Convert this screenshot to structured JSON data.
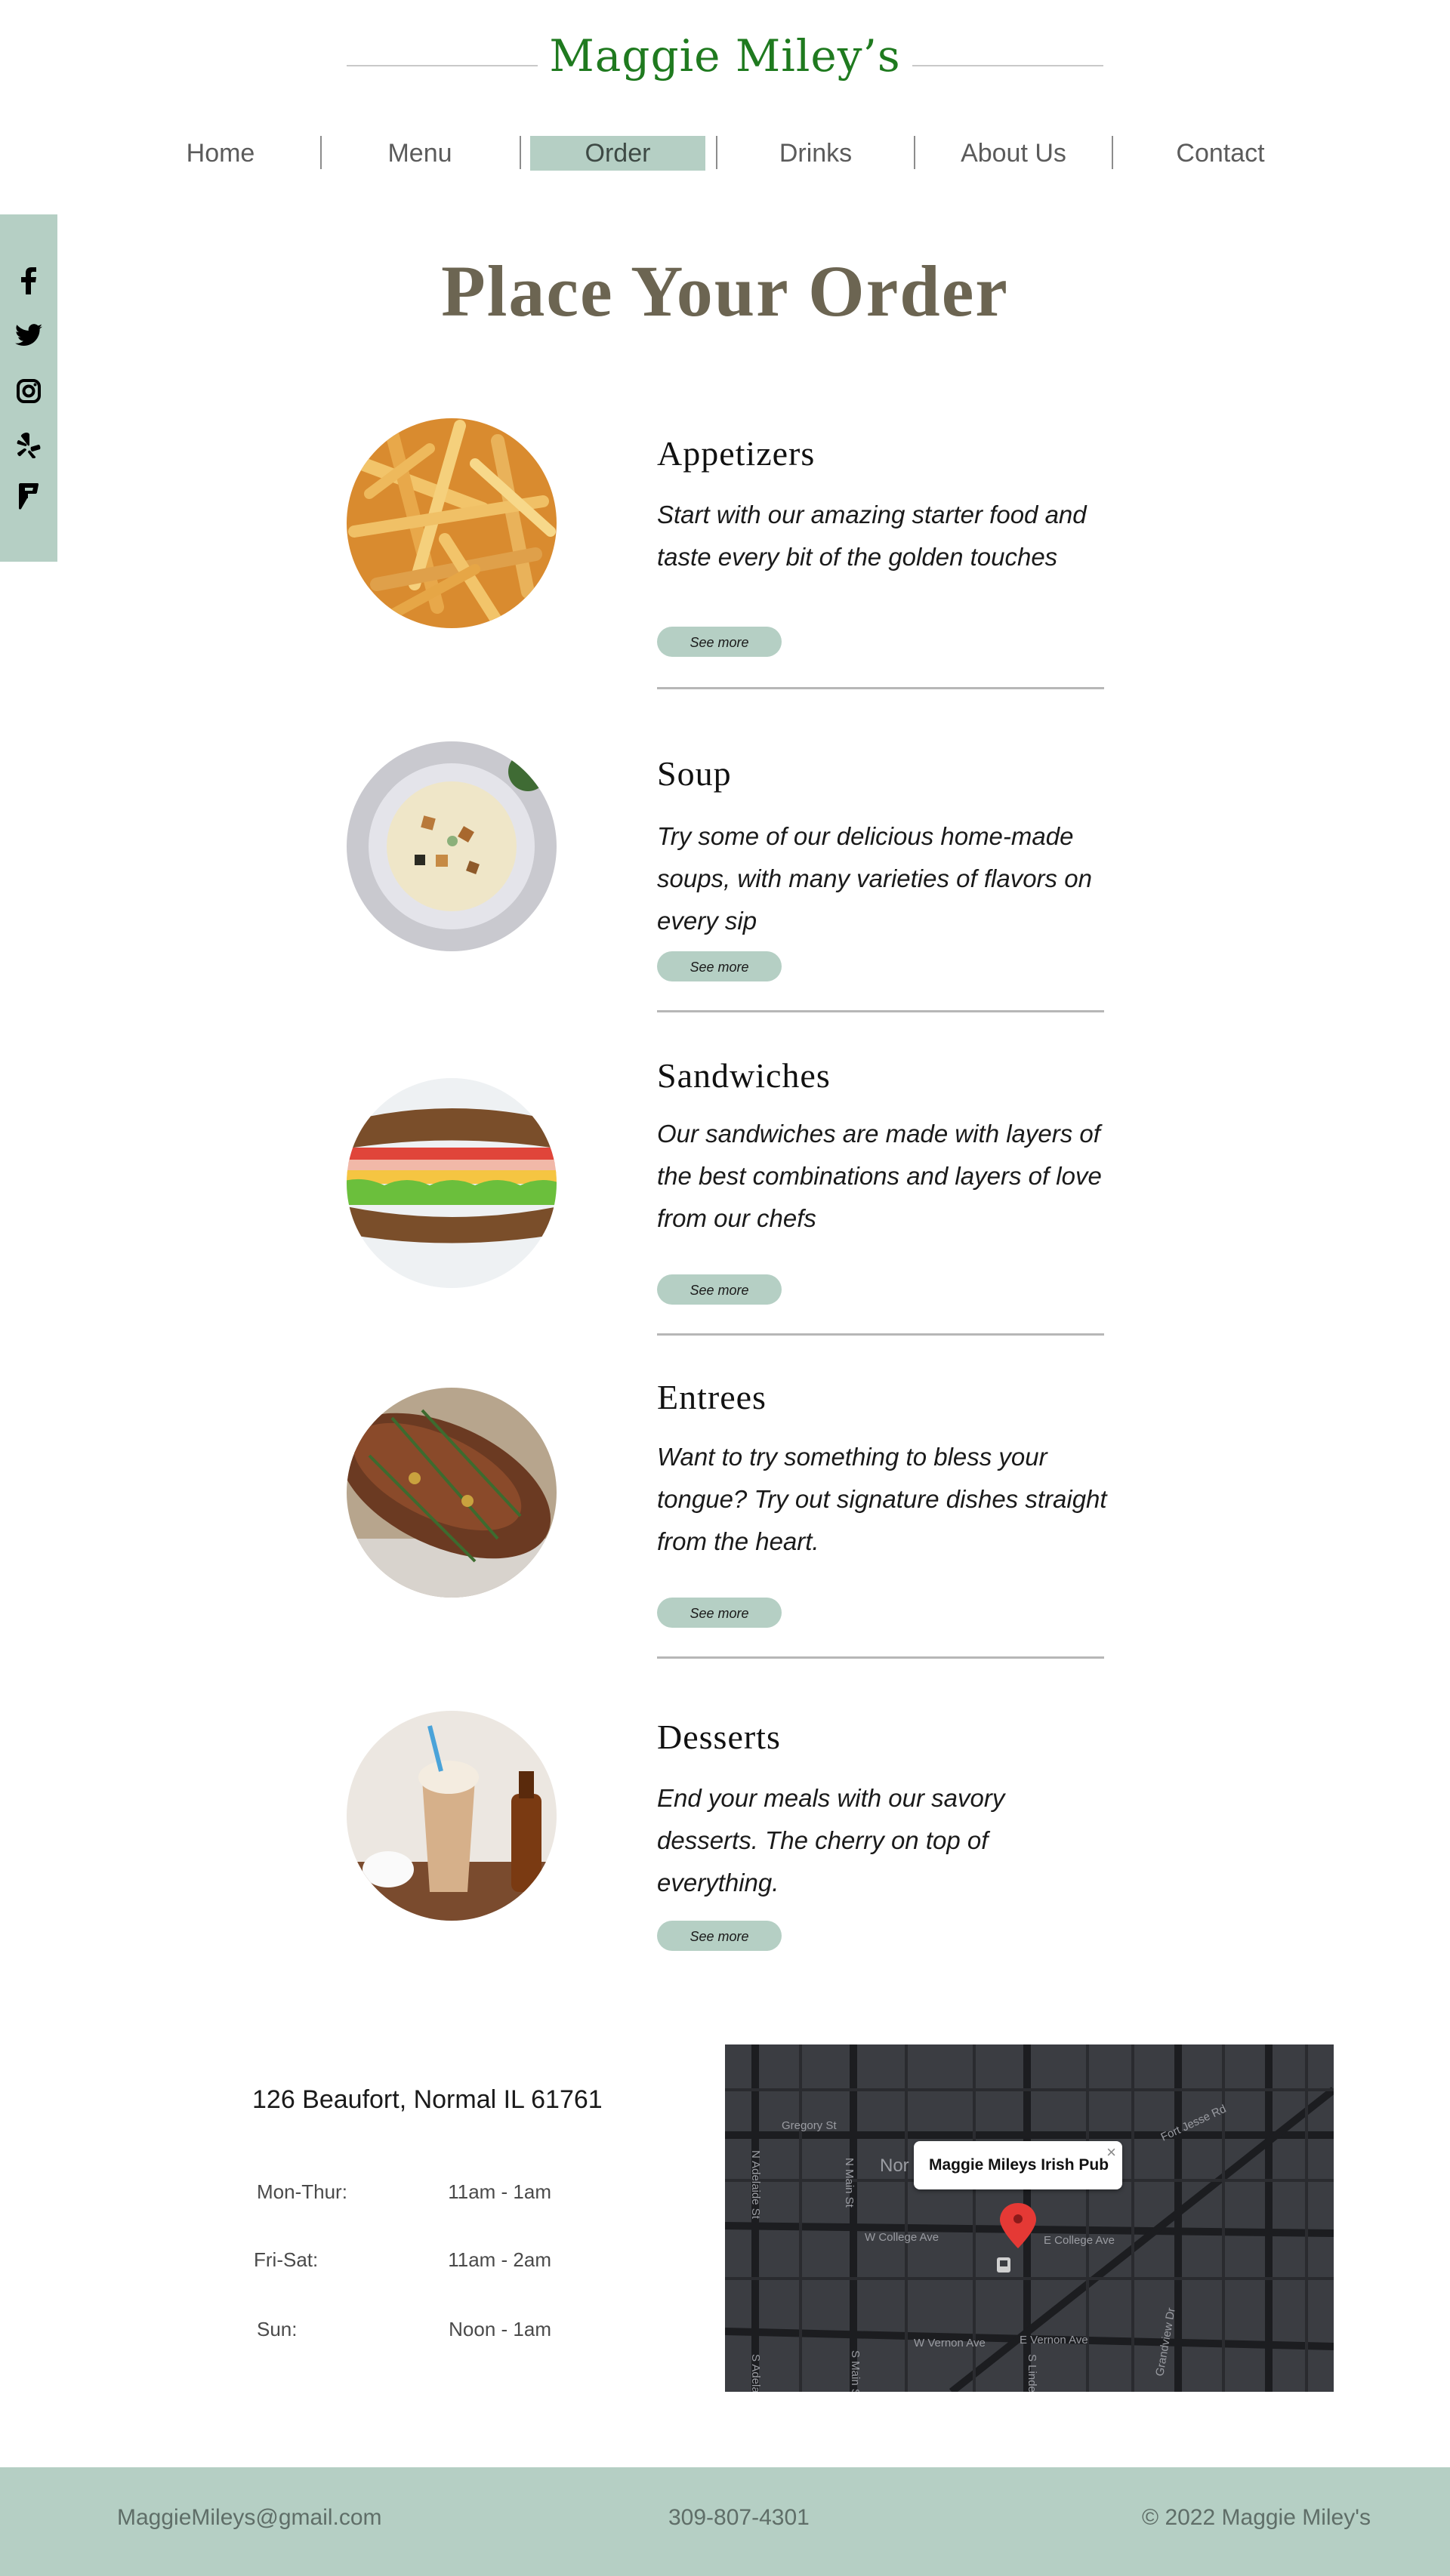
{
  "header": {
    "brand": "Maggie Miley’s",
    "nav": [
      {
        "label": "Home",
        "active": false
      },
      {
        "label": "Menu",
        "active": false
      },
      {
        "label": "Order",
        "active": true
      },
      {
        "label": "Drinks",
        "active": false
      },
      {
        "label": "About Us",
        "active": false
      },
      {
        "label": "Contact",
        "active": false
      }
    ]
  },
  "social": {
    "icons": [
      "facebook-icon",
      "twitter-icon",
      "instagram-icon",
      "yelp-icon",
      "foursquare-icon"
    ]
  },
  "main": {
    "title": "Place Your Order",
    "categories": [
      {
        "title": "Appetizers",
        "description": "Start with our amazing starter food and taste every bit of the golden touches",
        "button": "See more",
        "image": "fries"
      },
      {
        "title": "Soup",
        "description": "Try some of our delicious home-made soups, with many varieties of flavors on every sip",
        "button": "See more",
        "image": "soup"
      },
      {
        "title": "Sandwiches",
        "description": "Our sandwiches are made with layers of the best combinations and layers of love from our chefs",
        "button": "See more",
        "image": "sandwich"
      },
      {
        "title": "Entrees",
        "description": "Want to try something to bless your tongue? Try out signature dishes straight from the heart.",
        "button": "See more",
        "image": "roast"
      },
      {
        "title": "Desserts",
        "description": "End your meals with our savory desserts. The cherry on top of everything.",
        "button": "See more",
        "image": "milkshake"
      }
    ]
  },
  "info": {
    "address": "126 Beaufort, Normal IL 61761",
    "hours": [
      {
        "day": "Mon-Thur:",
        "time": "11am - 1am"
      },
      {
        "day": "Fri-Sat:",
        "time": "11am - 2am"
      },
      {
        "day": "Sun:",
        "time": "Noon - 1am"
      }
    ]
  },
  "map": {
    "popup_title": "Maggie Mileys Irish Pub",
    "street_labels": [
      "Gregory St",
      "W College Ave",
      "E College Ave",
      "W Vernon Ave",
      "E Vernon Ave",
      "Fort Jesse Rd",
      "N Adelaide St",
      "N Main St",
      "S Adelaide",
      "S Main St",
      "S Linden",
      "Grandview Dr",
      "Nor"
    ]
  },
  "footer": {
    "email": "MaggieMileys@gmail.com",
    "phone": "309-807-4301",
    "copyright": "© 2022 Maggie Miley's"
  }
}
